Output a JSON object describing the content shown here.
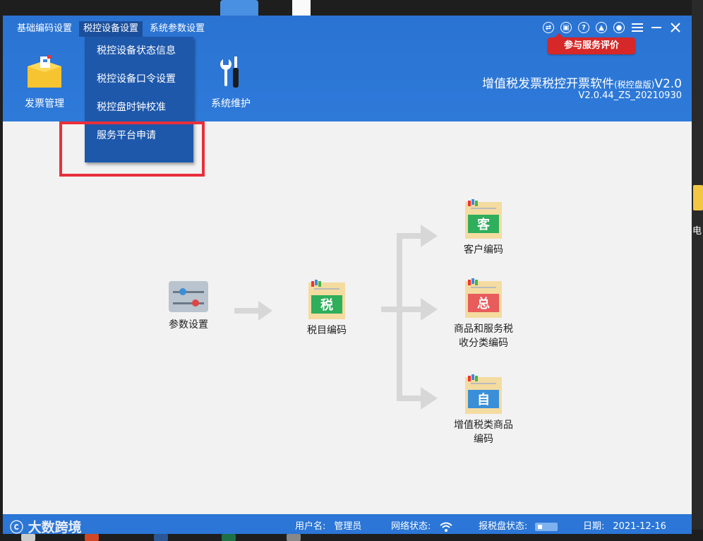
{
  "menu": {
    "items": [
      "基础编码设置",
      "税控设备设置",
      "系统参数设置"
    ]
  },
  "dropdown": {
    "items": [
      "税控设备状态信息",
      "税控设备口令设置",
      "税控盘时钟校准",
      "服务平台申请"
    ]
  },
  "toolbar": {
    "invoice_label": "发票管理",
    "maintenance_label": "系统维护"
  },
  "feedback_label": "参与服务评价",
  "app": {
    "title": "增值税发票税控开票软件",
    "edition": "(税控盘版)",
    "version_short": "V2.0",
    "build": "V2.0.44_ZS_20210930"
  },
  "flow": {
    "param": "参数设置",
    "tax_item": "税目编码",
    "tax_item_glyph": "税",
    "customer": "客户编码",
    "customer_glyph": "客",
    "goods_line1": "商品和服务税",
    "goods_line2": "收分类编码",
    "goods_glyph": "总",
    "vat_line1": "增值税类商品",
    "vat_line2": "编码",
    "vat_glyph": "自"
  },
  "status": {
    "user_label": "用户名:",
    "user_value": "管理员",
    "network_label": "网络状态:",
    "disk_label": "报税盘状态:",
    "date_label": "日期:",
    "date_value": "2021-12-16"
  },
  "watermark": "大数跨境",
  "desktop_char": "电",
  "colors": {
    "header": "#2e7ad9",
    "dropdown": "#1e58ab",
    "highlight": "#e8303a",
    "feedback": "#d62828"
  }
}
